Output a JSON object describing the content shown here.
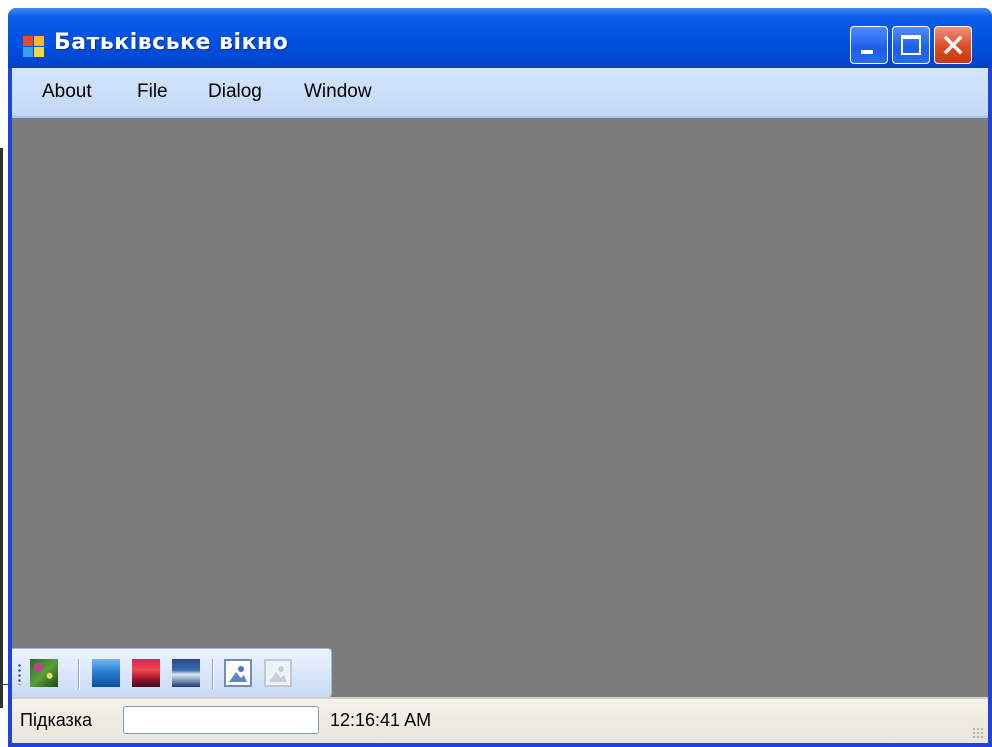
{
  "window": {
    "title": "Батьківське вікно"
  },
  "menu": {
    "items": [
      "About",
      "File",
      "Dialog",
      "Window"
    ]
  },
  "toolbar": {
    "buttons": [
      {
        "icon": "flowers-image-icon"
      },
      {
        "icon": "blue-hills-image-icon"
      },
      {
        "icon": "sunset-image-icon"
      },
      {
        "icon": "winter-image-icon"
      },
      {
        "icon": "picture-icon"
      },
      {
        "icon": "picture-disabled-icon"
      }
    ]
  },
  "status": {
    "hint_label": "Підказка",
    "field_value": "",
    "time": "12:16:41 AM"
  },
  "colors": {
    "title_bar": "#0050e0",
    "mdi_background": "#7c7c7c",
    "menu_bar": "#c3d8f7",
    "status_bar": "#ece9d8",
    "close_button": "#df4a22"
  }
}
